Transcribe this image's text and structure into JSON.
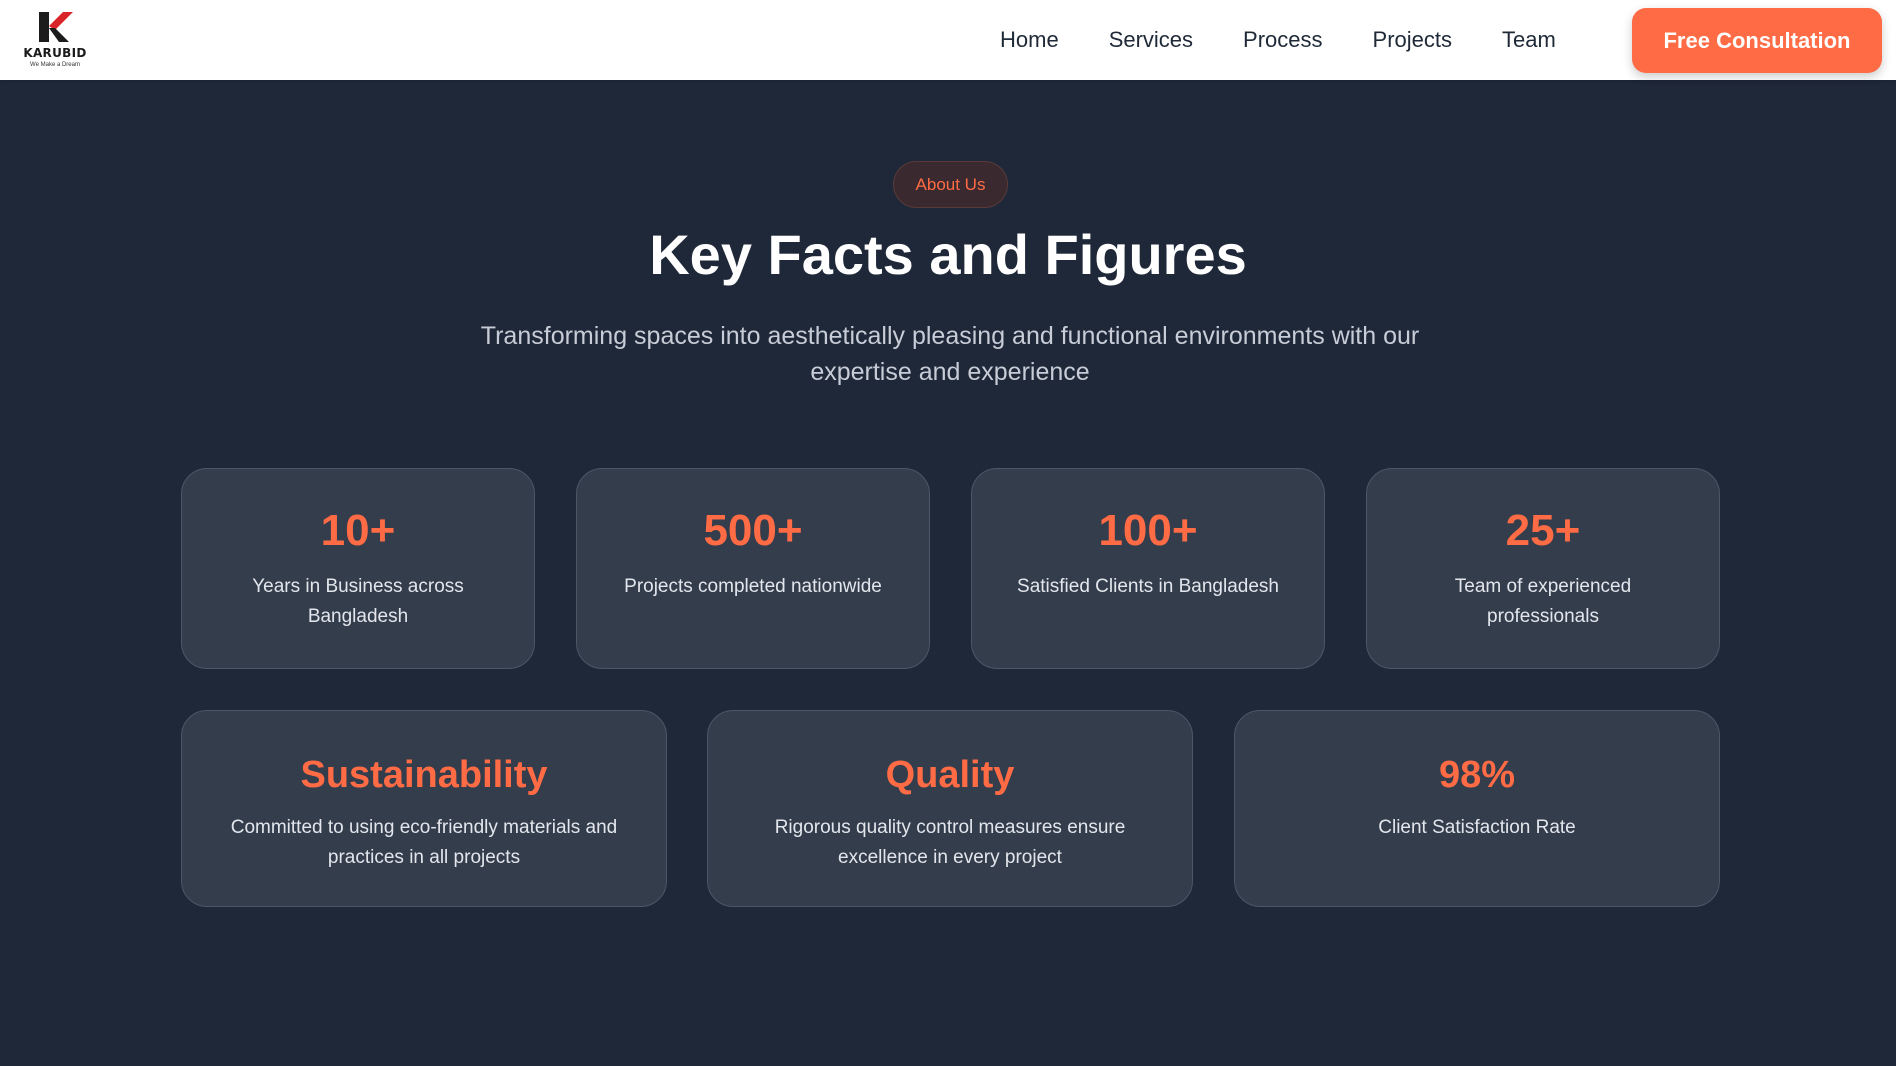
{
  "nav": {
    "logo_text": "KARUBID",
    "logo_tagline": "We Make a Dream",
    "links": [
      "Home",
      "Services",
      "Process",
      "Projects",
      "Team"
    ],
    "cta_label": "Free Consultation"
  },
  "section": {
    "badge": "About Us",
    "title": "Key Facts and Figures",
    "subtitle": "Transforming spaces into aesthetically pleasing and functional environments with our expertise and experience"
  },
  "stats": [
    {
      "value": "10+",
      "desc": "Years in Business across Bangladesh"
    },
    {
      "value": "500+",
      "desc": "Projects completed nationwide"
    },
    {
      "value": "100+",
      "desc": "Satisfied Clients in Bangladesh"
    },
    {
      "value": "25+",
      "desc": "Team of experienced professionals"
    }
  ],
  "features": [
    {
      "value": "Sustainability",
      "desc": "Committed to using eco-friendly materials and practices in all projects"
    },
    {
      "value": "Quality",
      "desc": "Rigorous quality control measures ensure excellence in every project"
    },
    {
      "value": "98%",
      "desc": "Client Satisfaction Rate"
    }
  ],
  "colors": {
    "accent": "#ff6b45",
    "background": "#1f2839",
    "card": "#343d4c"
  }
}
